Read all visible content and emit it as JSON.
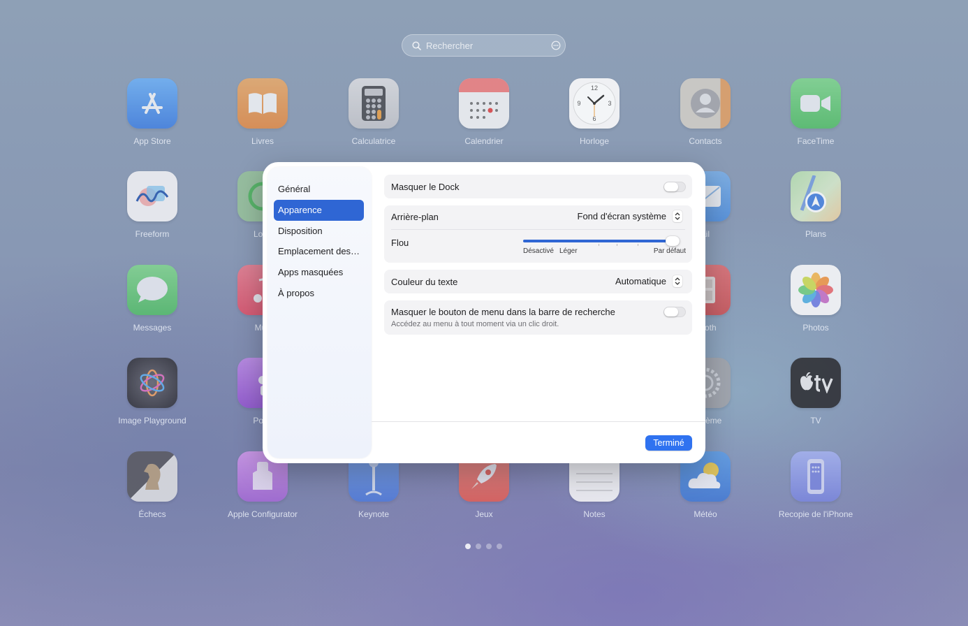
{
  "search": {
    "placeholder": "Rechercher",
    "icon": "magnifier-icon",
    "menu_icon": "ellipsis-circle-icon"
  },
  "apps": [
    {
      "label": "App Store",
      "color": "#5aa0f0"
    },
    {
      "label": "Livres",
      "color": "#f39a45"
    },
    {
      "label": "Calculatrice",
      "color": "#c9c9cc"
    },
    {
      "label": "Calendrier",
      "color": "#ffffff"
    },
    {
      "label": "Horloge",
      "color": "#ffffff"
    },
    {
      "label": "Contacts",
      "color": "#d7c9b0"
    },
    {
      "label": "FaceTime",
      "color": "#5fd06a"
    },
    {
      "label": "Freeform",
      "color": "#ffffff"
    },
    {
      "label": "Loca",
      "color": "#5fd06a"
    },
    {
      "label": "ail",
      "color": "#5aa0f0"
    },
    {
      "label": "Plans",
      "color": "#a8d8a0"
    },
    {
      "label": "Messages",
      "color": "#5fd06a"
    },
    {
      "label": "Mus",
      "color": "#f05a6e"
    },
    {
      "label": "Booth",
      "color": "#e05050"
    },
    {
      "label": "Photos",
      "color": "#ffffff"
    },
    {
      "label": "Image Playground",
      "color": "#3a3a40"
    },
    {
      "label": "Podc",
      "color": "#b46ee8"
    },
    {
      "label": "Système",
      "color": "#9a9aa0"
    },
    {
      "label": "TV",
      "color": "#2a2a2e"
    },
    {
      "label": "Échecs",
      "color": "#4a4a50"
    },
    {
      "label": "Apple Configurator",
      "color": "#c882e6"
    },
    {
      "label": "Keynote",
      "color": "#5a8ae6"
    },
    {
      "label": "Jeux",
      "color": "#f06a5a"
    },
    {
      "label": "Notes",
      "color": "#fafafa"
    },
    {
      "label": "Météo",
      "color": "#4a90e6"
    },
    {
      "label": "Recopie de l'iPhone",
      "color": "#8a9ae8"
    }
  ],
  "pager": {
    "pages": 4,
    "current": 1
  },
  "dialog": {
    "sidebar": [
      {
        "label": "Général"
      },
      {
        "label": "Apparence",
        "active": true
      },
      {
        "label": "Disposition"
      },
      {
        "label": "Emplacement des…"
      },
      {
        "label": "Apps masquées"
      },
      {
        "label": "À propos"
      }
    ],
    "hide_dock": {
      "label": "Masquer le Dock",
      "on": false
    },
    "background": {
      "label": "Arrière-plan",
      "value": "Fond d'écran système"
    },
    "blur": {
      "label": "Flou",
      "level_percent": 100,
      "labels": [
        "Désactivé",
        "Léger",
        "Par défaut"
      ]
    },
    "text_color": {
      "label": "Couleur du texte",
      "value": "Automatique"
    },
    "hide_menu_button": {
      "label": "Masquer le bouton de menu dans la barre de recherche",
      "description": "Accédez au menu à tout moment via un clic droit.",
      "on": false
    },
    "done_button": "Terminé",
    "accent": "#2f66d4"
  }
}
